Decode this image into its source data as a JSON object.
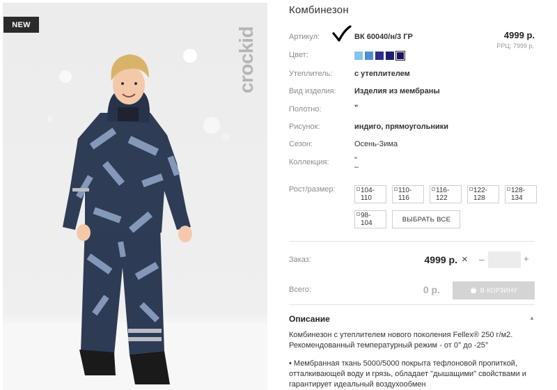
{
  "photo": {
    "badge": "NEW",
    "brand": "crockid"
  },
  "product": {
    "title": "Комбинезон",
    "article_label": "Артикул:",
    "article_value": "ВК 60040/н/3 ГР",
    "price": "4999 р.",
    "rrp": "РРЦ: 7999 р.",
    "color_label": "Цвет:",
    "colors": [
      "#86c3ee",
      "#4f8fd1",
      "#2f2f8a",
      "#1e1e72",
      "#1b1460"
    ],
    "specs": [
      {
        "label": "Утеплитель:",
        "value": "с утеплителем"
      },
      {
        "label": "Вид изделия:",
        "value": "Изделия из мембраны"
      },
      {
        "label": "Полотно:",
        "value": "\""
      },
      {
        "label": "Рисунок:",
        "value": "индиго, прямоугольники"
      },
      {
        "label": "Сезон:",
        "value": "Осень-Зима"
      },
      {
        "label": "Коллекция:",
        "value": "\" –"
      }
    ],
    "size_label": "Рост/размер:",
    "sizes": [
      "104-110",
      "110-116",
      "116-122",
      "122-128",
      "128-134",
      "98-104"
    ],
    "select_all": "ВЫБРАТЬ ВСЕ"
  },
  "order": {
    "label": "Заказ:",
    "price": "4999 р.",
    "times": "×",
    "minus": "–",
    "plus": "+",
    "qty": ""
  },
  "total": {
    "label": "Всего:",
    "value": "0 р.",
    "cart_button": "В КОРЗИНУ"
  },
  "description": {
    "heading": "Описание",
    "toggle": "▲",
    "line1": "Комбинезон с утеплителем нового поколения Fellex® 250 г/м2.",
    "line2": "Рекомендованный температурный режим - от 0° до -25°",
    "line3": "• Мембранная ткань 5000/5000 покрыта тефлоновой пропиткой,",
    "line4": "отталкивающей воду и грязь, обладает \"дышащими\" свойствами и",
    "line5": "гарантирует идеальный воздухообмен"
  }
}
